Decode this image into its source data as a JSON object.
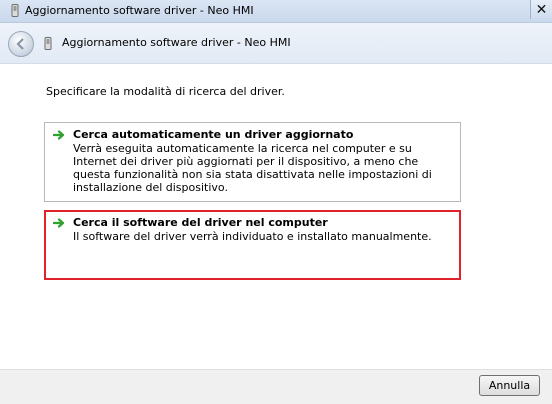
{
  "window": {
    "title": "Aggiornamento software driver - Neo HMI"
  },
  "nav": {
    "title": "Aggiornamento software driver - Neo HMI"
  },
  "content": {
    "instruction": "Specificare la modalità di ricerca del driver.",
    "options": [
      {
        "title": "Cerca automaticamente un driver aggiornato",
        "description": "Verrà eseguita automaticamente la ricerca nel computer e su Internet dei driver più aggiornati per il dispositivo, a meno che questa funzionalità non sia stata disattivata nelle impostazioni di installazione del dispositivo.",
        "icon": "green-arrow-icon"
      },
      {
        "title": "Cerca il software del driver nel computer",
        "description": "Il software del driver verrà individuato e installato manualmente.",
        "icon": "green-arrow-icon",
        "highlight_color": "#e0232a"
      }
    ]
  },
  "footer": {
    "cancel_label": "Annulla"
  },
  "colors": {
    "arrow": "#2ea12e",
    "highlight": "#e0232a"
  }
}
